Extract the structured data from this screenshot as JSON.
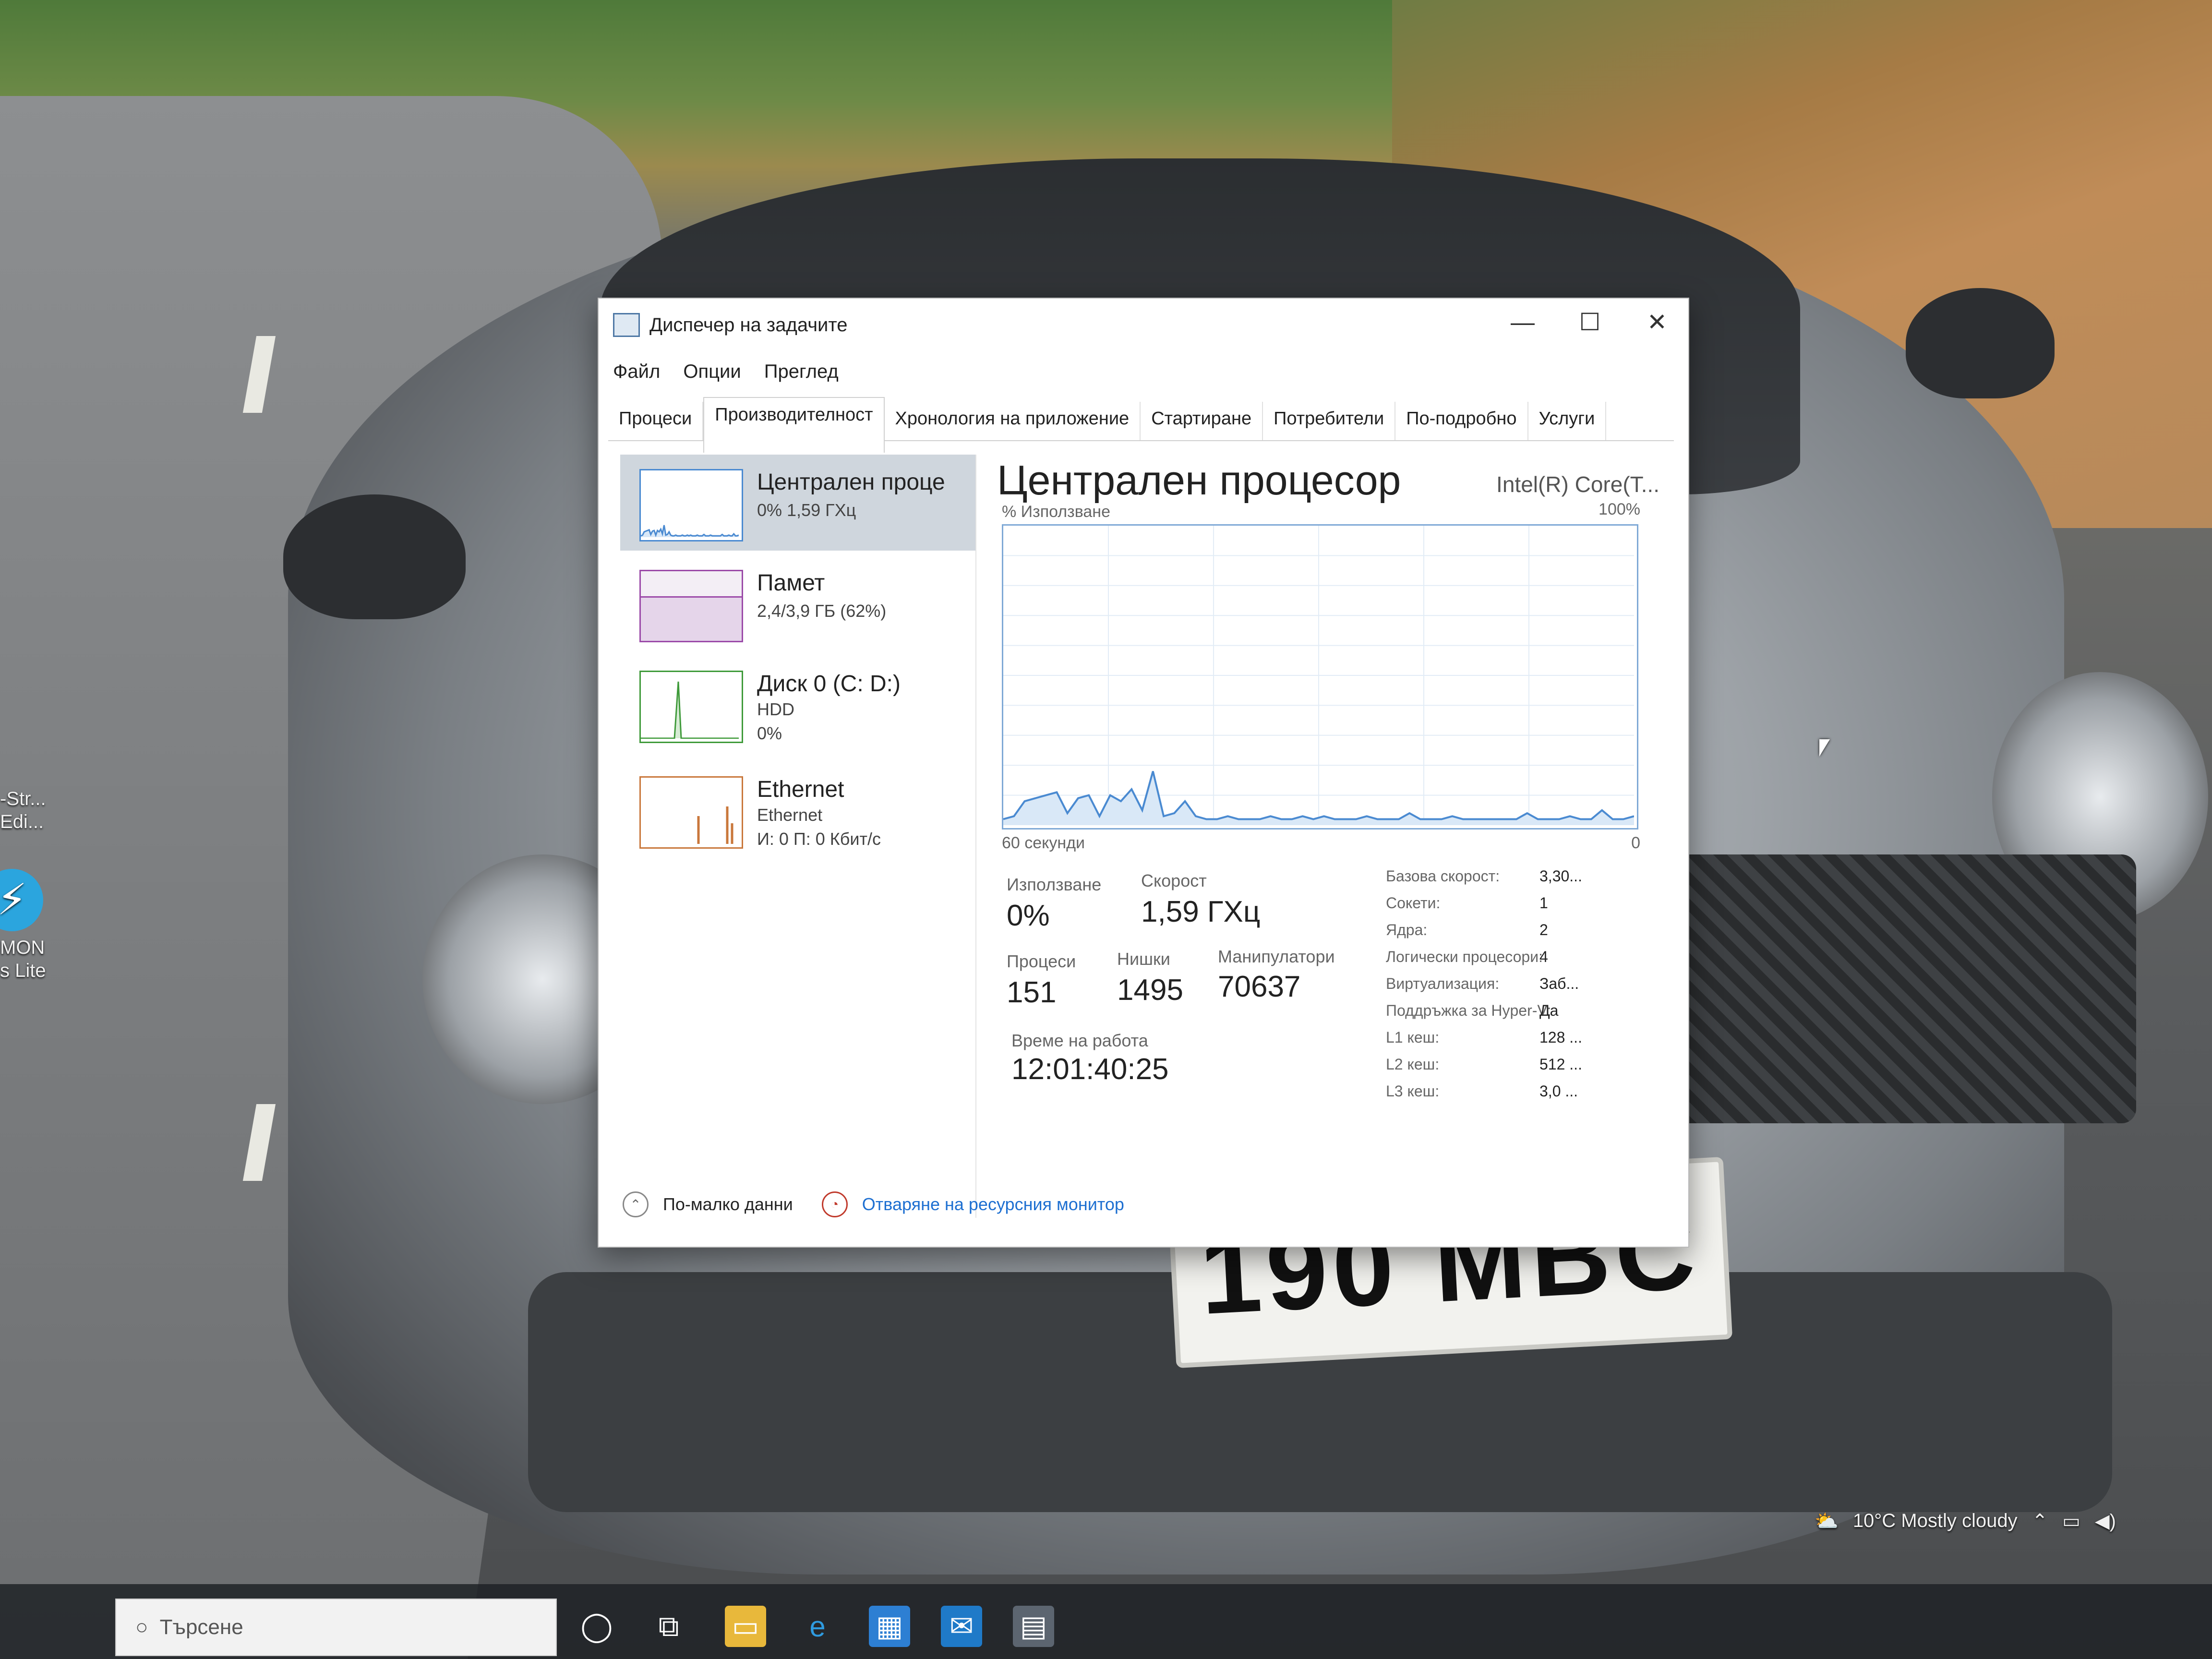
{
  "window": {
    "title": "Диспечер на задачите",
    "controls": {
      "minimize": "—",
      "maximize": "☐",
      "close": "✕"
    }
  },
  "menu": [
    "Файл",
    "Опции",
    "Преглед"
  ],
  "tabs": [
    "Процеси",
    "Производителност",
    "Хронология на приложение",
    "Стартиране",
    "Потребители",
    "По-подробно",
    "Услуги"
  ],
  "active_tab": "Производителност",
  "sidebar": {
    "items": [
      {
        "title": "Централен проце",
        "line1": "0% 1,59 ГХц",
        "line2": "",
        "line3": ""
      },
      {
        "title": "Памет",
        "line1": "2,4/3,9 ГБ (62%)",
        "line2": "",
        "line3": ""
      },
      {
        "title": "Диск 0 (C: D:)",
        "line1": "HDD",
        "line2": "0%",
        "line3": ""
      },
      {
        "title": "Ethernet",
        "line1": "Ethernet",
        "line2": "И: 0 П: 0 Кбит/с",
        "line3": ""
      }
    ]
  },
  "main": {
    "title": "Централен процесор",
    "model": "Intel(R) Core(T...",
    "graph_label": "% Използване",
    "graph_max": "100%",
    "graph_time": "60 секунди",
    "graph_min": "0",
    "usage_label": "Използване",
    "usage_value": "0%",
    "speed_label": "Скорост",
    "speed_value": "1,59 ГХц",
    "processes_label": "Процеси",
    "processes_value": "151",
    "threads_label": "Нишки",
    "threads_value": "1495",
    "handles_label": "Манипулатори",
    "handles_value": "70637",
    "uptime_label": "Време на работа",
    "uptime_value": "12:01:40:25",
    "specs": [
      {
        "label": "Базова скорост:",
        "value": "3,30..."
      },
      {
        "label": "Сокети:",
        "value": "1"
      },
      {
        "label": "Ядра:",
        "value": "2"
      },
      {
        "label": "Логически процесори:",
        "value": "4"
      },
      {
        "label": "Виртуализация:",
        "value": "Заб..."
      },
      {
        "label": "Поддръжка за Hyper-V:",
        "value": "Да"
      },
      {
        "label": "L1 кеш:",
        "value": "128 ..."
      },
      {
        "label": "L2 кеш:",
        "value": "512 ..."
      },
      {
        "label": "L3 кеш:",
        "value": "3,0 ..."
      }
    ]
  },
  "footer": {
    "less_details": "По-малко данни",
    "open_monitor": "Отваряне на ресурсния монитор"
  },
  "cpu_history": [
    2,
    3,
    8,
    9,
    10,
    11,
    4,
    9,
    10,
    3,
    10,
    8,
    12,
    5,
    18,
    3,
    4,
    8,
    3,
    2,
    2,
    3,
    2,
    2,
    2,
    3,
    2,
    2,
    3,
    2,
    3,
    2,
    2,
    2,
    3,
    2,
    2,
    2,
    4,
    2,
    2,
    2,
    3,
    2,
    2,
    2,
    2,
    2,
    2,
    4,
    2,
    2,
    2,
    3,
    2,
    2,
    5,
    2,
    2,
    3
  ],
  "desktop": {
    "icon1_line1": "-Str...",
    "icon1_line2": "Edi...",
    "icon2_glyph": "⚡",
    "icon2_line1": "MON",
    "icon2_line2": "s Lite",
    "plate": "190 MBC"
  },
  "taskbar": {
    "search_placeholder": "Търсене",
    "weather": "10°C  Mostly cloudy"
  },
  "colors": {
    "cpu_line": "#4a8ad1",
    "cpu_fill": "#d9e8f7",
    "mem": "#9b4aa8",
    "disk": "#3f9a3a",
    "eth": "#c9773b",
    "selected": "#cfd6dd"
  }
}
